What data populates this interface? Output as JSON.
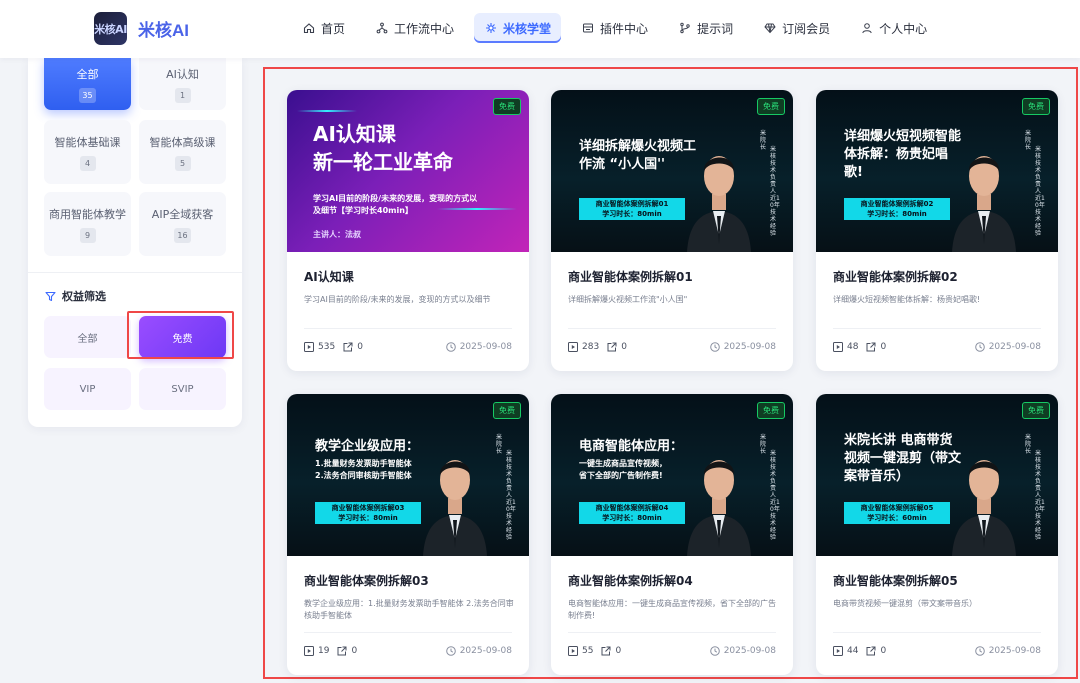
{
  "header": {
    "brand": "米核AI",
    "logo_text": "米核AI",
    "nav": [
      {
        "label": "首页",
        "icon": "home-icon"
      },
      {
        "label": "工作流中心",
        "icon": "workflow-icon"
      },
      {
        "label": "米核学堂",
        "icon": "academy-icon",
        "active": true
      },
      {
        "label": "插件中心",
        "icon": "plugin-icon"
      },
      {
        "label": "提示词",
        "icon": "prompt-icon"
      },
      {
        "label": "订阅会员",
        "icon": "diamond-icon"
      },
      {
        "label": "个人中心",
        "icon": "user-icon"
      }
    ]
  },
  "sidebar": {
    "categories": [
      {
        "label": "全部",
        "count": "35",
        "active": true
      },
      {
        "label": "AI认知",
        "count": "1"
      },
      {
        "label": "智能体基础课",
        "count": "4"
      },
      {
        "label": "智能体高级课",
        "count": "5"
      },
      {
        "label": "商用智能体教学",
        "count": "9"
      },
      {
        "label": "AIP全域获客",
        "count": "16"
      }
    ],
    "filter_title": "权益筛选",
    "benefits": [
      {
        "label": "全部"
      },
      {
        "label": "免费",
        "active": true
      },
      {
        "label": "VIP"
      },
      {
        "label": "SVIP"
      }
    ]
  },
  "courses": [
    {
      "title": "AI认知课",
      "desc": "学习AI目前的阶段/未来的发展，变现的方式以及细节",
      "views": "535",
      "shares": "0",
      "date": "2025-09-08",
      "tag": "免费",
      "thumb": {
        "style": "purple",
        "title": "AI认知课\n新一轮工业革命",
        "sub": "学习AI目前的阶段/未来的发展，变现的方式以及细节【学习时长40min】",
        "speaker": "主讲人：法叔"
      }
    },
    {
      "title": "商业智能体案例拆解01",
      "desc": "详细拆解爆火视频工作流\"小人国\"",
      "views": "283",
      "shares": "0",
      "date": "2025-09-08",
      "tag": "免费",
      "thumb": {
        "style": "dark",
        "title": "详细拆解爆火视频工作流 “小人国''",
        "lesson": "商业智能体案例拆解01\n学习时长：80min",
        "side_a": "米院长",
        "side_b": "米核技术负责人近10年技术经验"
      }
    },
    {
      "title": "商业智能体案例拆解02",
      "desc": "详细爆火短视频智能体拆解：杨贵妃唱歌!",
      "views": "48",
      "shares": "0",
      "date": "2025-09-08",
      "tag": "免费",
      "thumb": {
        "style": "dark",
        "title": "详细爆火短视频智能体拆解：杨贵妃唱歌!",
        "lesson": "商业智能体案例拆解02\n学习时长：80min",
        "side_a": "米院长",
        "side_b": "米核技术负责人近10年技术经验"
      }
    },
    {
      "title": "商业智能体案例拆解03",
      "desc": "教学企业级应用：1.批量财务发票助手智能体 2.法务合同审核助手智能体",
      "views": "19",
      "shares": "0",
      "date": "2025-09-08",
      "tag": "免费",
      "thumb": {
        "style": "dark",
        "title": "教学企业级应用：",
        "sub": "1.批量财务发票助手智能体\n2.法务合同审核助手智能体",
        "lesson": "商业智能体案例拆解03\n学习时长：80min",
        "side_a": "米院长",
        "side_b": "米核技术负责人近10年技术经验"
      }
    },
    {
      "title": "商业智能体案例拆解04",
      "desc": "电商智能体应用：一键生成商品宣传视频，省下全部的广告制作费!",
      "views": "55",
      "shares": "0",
      "date": "2025-09-08",
      "tag": "免费",
      "thumb": {
        "style": "dark",
        "title": "电商智能体应用：",
        "sub": "一键生成商品宣传视频，\n省下全部的广告制作费!",
        "lesson": "商业智能体案例拆解04\n学习时长：80min",
        "side_a": "米院长",
        "side_b": "米核技术负责人近10年技术经验"
      }
    },
    {
      "title": "商业智能体案例拆解05",
      "desc": "电商带货视频一键混剪（带文案带音乐）",
      "views": "44",
      "shares": "0",
      "date": "2025-09-08",
      "tag": "免费",
      "thumb": {
        "style": "dark",
        "title": "米院长讲 电商带货视频一键混剪（带文案带音乐）",
        "lesson": "商业智能体案例拆解05\n学习时长：60min",
        "side_a": "米院长",
        "side_b": "米核技术负责人近10年技术经验"
      }
    }
  ],
  "colors": {
    "accent": "#3d6aff",
    "free_tag": "#2ae07a",
    "highlight_outline": "#ef4747",
    "benefit_active": "#7a3ff8"
  }
}
